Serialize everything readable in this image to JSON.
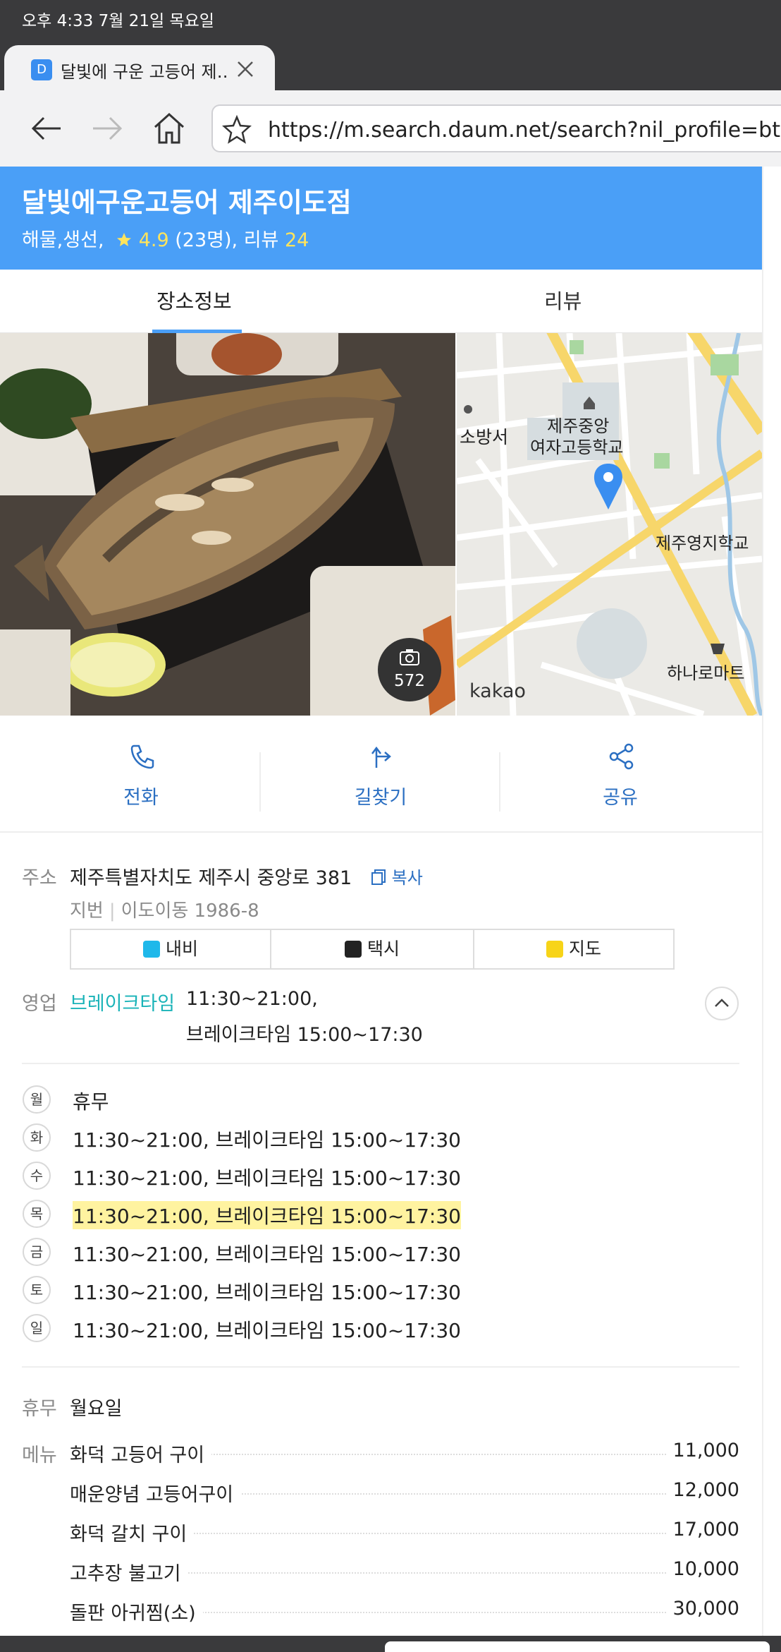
{
  "status_bar": {
    "time_date": "오후 4:33   7월 21일 목요일"
  },
  "browser": {
    "tab_favicon": "D",
    "tab_title": "달빛에 구운 고등어 제…",
    "url": "https://m.search.daum.net/search?nil_profile=btn&"
  },
  "place": {
    "name": "달빛에구운고등어 제주이도점",
    "category": "해물,생선,",
    "rating": "4.9",
    "rating_count": "(23명), 리뷰",
    "review_count": "24"
  },
  "tabs": [
    {
      "label": "장소정보"
    },
    {
      "label": "리뷰"
    }
  ],
  "photo": {
    "count": "572"
  },
  "map": {
    "labels": [
      "소방서",
      "제주중앙",
      "여자고등학교",
      "제주영지학교",
      "하나로마트"
    ],
    "brand": "kakao"
  },
  "actions": [
    {
      "label": "전화"
    },
    {
      "label": "길찾기"
    },
    {
      "label": "공유"
    }
  ],
  "address": {
    "label": "주소",
    "value": "제주특별자치도 제주시 중앙로 381",
    "copy": "복사",
    "jibun_label": "지번",
    "jibun": "이도이동 1986-8"
  },
  "nav_buttons": [
    {
      "label": "내비",
      "color": "#1fb8ea"
    },
    {
      "label": "택시",
      "color": "#222222"
    },
    {
      "label": "지도",
      "color": "#f7d418"
    }
  ],
  "hours": {
    "label": "영업",
    "status": "브레이크타임",
    "summary_1": "11:30~21:00,",
    "summary_2": "브레이크타임 15:00~17:30",
    "days": [
      {
        "day": "월",
        "text": "휴무"
      },
      {
        "day": "화",
        "text": "11:30~21:00, 브레이크타임 15:00~17:30"
      },
      {
        "day": "수",
        "text": "11:30~21:00, 브레이크타임 15:00~17:30"
      },
      {
        "day": "목",
        "text": "11:30~21:00, 브레이크타임 15:00~17:30"
      },
      {
        "day": "금",
        "text": "11:30~21:00, 브레이크타임 15:00~17:30"
      },
      {
        "day": "토",
        "text": "11:30~21:00, 브레이크타임 15:00~17:30"
      },
      {
        "day": "일",
        "text": "11:30~21:00, 브레이크타임 15:00~17:30"
      }
    ]
  },
  "closed": {
    "label": "휴무",
    "value": "월요일"
  },
  "menu": {
    "label": "메뉴",
    "items": [
      {
        "name": "화덕 고등어 구이",
        "price": "11,000"
      },
      {
        "name": "매운양념 고등어구이",
        "price": "12,000"
      },
      {
        "name": "화덕 갈치 구이",
        "price": "17,000"
      },
      {
        "name": "고추장 불고기",
        "price": "10,000"
      },
      {
        "name": "돌판 아귀찜(소)",
        "price": "30,000"
      }
    ]
  },
  "colors": {
    "header_bg": "#4a9ff7",
    "link_blue": "#2b6fc2",
    "status_teal": "#1ab3b8",
    "highlight": "#fff3a0"
  }
}
